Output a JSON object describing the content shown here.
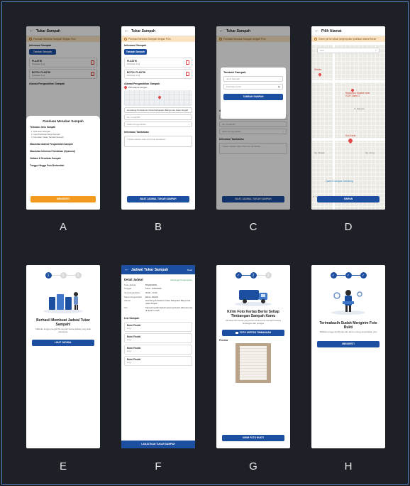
{
  "labels": [
    "A",
    "B",
    "C",
    "D",
    "E",
    "F",
    "G",
    "H"
  ],
  "screenA": {
    "title": "Tukar Sampah",
    "warning": "Panduan Menukar Sampah dengan Poin",
    "info_section": "Informasi Sampah",
    "add_button": "Tambah Sampah",
    "items": [
      {
        "name": "PLASTIK",
        "qty": "Perkiraan 1 kg"
      },
      {
        "name": "BOTOL PLASTIK",
        "qty": "Perkiraan 1 kg"
      }
    ],
    "pickup_label": "Alamat Pengambilan Sampah",
    "sheet_title": "Panduan Menukar Sampah",
    "guide": [
      {
        "title": "Tentukan Jenis Sampah",
        "subs": [
          "1. Pilih Jenis Sampah",
          "2. Input Perkiraan Berat Sampah",
          "3. Kemudian Tekan Tambah Sampah"
        ]
      },
      {
        "title": "Masukkan Alamat Pengambilan Sampah",
        "subs": []
      },
      {
        "title": "Masukkan Informasi Tambahan (Opsional)",
        "subs": []
      },
      {
        "title": "Validasi & Serahkan Sampah",
        "subs": []
      },
      {
        "title": "Tunggu Hingga Poin Bertambah",
        "subs": []
      }
    ],
    "sheet_button": "MENGERTI"
  },
  "screenB": {
    "title": "Tukar Sampah",
    "warning": "Panduan Menukar Sampah dengan Poin",
    "info_section": "Informasi Sampah",
    "add_button": "Tambah Sampah",
    "items": [
      {
        "name": "PLASTIK",
        "qty": "Perkiraan 1 kg"
      },
      {
        "name": "BOTOL PLASTIK",
        "qty": "Perkiraan 1 kg"
      }
    ],
    "pickup_label": "Alamat Pengambilan Sampah",
    "pick_address": "Pilih alamat dengan...",
    "address_text": "Grendeng Purwokerto Utara Kabupaten Banyumas Jawa Tengah",
    "rt_placeholder": "No. rumah/RT",
    "time_placeholder": "Waktu Pengambilan",
    "extra_label": "Informasi Tambahan",
    "extra_placeholder": "Tulisan catatan atau informasi tambahan...",
    "submit": "BUAT JADWAL TUKAR SAMPAH"
  },
  "screenC": {
    "title": "Tukar Sampah",
    "warning": "Panduan Menukar Sampah dengan Poin",
    "modal_title": "Tambah Sampah",
    "type_placeholder": "Jenis Sampah",
    "weight_placeholder": "Perkiraan berat",
    "unit": "kg",
    "modal_button": "TAMBAH SAMPAH",
    "pickup_label": "Alamat Pengambilan Sampah",
    "address_text": "Grendeng Purwokerto Utara Kabupaten Banyumas Jawa Tengah",
    "rt_placeholder": "No. rumah/RT",
    "time_placeholder": "Waktu Pengambilan",
    "extra_label": "Informasi Tambahan",
    "extra_placeholder": "Tulisan catatan atau informasi tambahan...",
    "submit": "BUAT JADWAL TUKAR SAMPAH"
  },
  "screenD": {
    "title": "Pilih Alamat",
    "warning": "Geser pin ke lokasi penjemputan pastikan alamat benar",
    "search_placeholder": "Cari",
    "places": [
      "Wisata",
      "RedDoorz Syariah near GOR Satria 4",
      "Kos Karla",
      "Queen Campus Grendeng"
    ],
    "streets": [
      "Jl. Kampus",
      "Gg. Mawar",
      "Gg. Ireng",
      "Jl. Kampus"
    ],
    "button": "SIMPAN"
  },
  "screenE": {
    "steps": [
      "1",
      "2",
      "3"
    ],
    "heading": "Berhasil Membuat Jadwal Tukar Sampah!",
    "text": "Silahkan tunggu pengambil sampah sesuai jadwal yang telah ditentukan",
    "button": "LIHAT JADWAL"
  },
  "screenF": {
    "title": "Jadwal Tukar Sampah",
    "action": "Batal",
    "section": "Detail Jadwal",
    "status": "Menunggu Penjemputan",
    "rows": [
      {
        "k": "Kode Jadwal",
        "v": "BSH0004811"
      },
      {
        "k": "Tanggal",
        "v": "Senin, 12/09/2022"
      },
      {
        "k": "Jam Pengambilan",
        "v": "09.00 - 12.00"
      },
      {
        "k": "Status Pengambilan",
        "v": "Belum Diambil"
      },
      {
        "k": "Alamat",
        "v": "Grendeng Purwokerto Utara Kabupaten Banyumas Jawa Tengah"
      },
      {
        "k": "Info",
        "v": "Sampah sudah dipisah sesuai jenis dan dikemas rapi di depan rumah"
      }
    ],
    "list_title": "List Sampah",
    "list": [
      {
        "name": "Botol Plastik",
        "qty": "1 kg"
      },
      {
        "name": "Botol Plastik",
        "qty": "1 kg"
      },
      {
        "name": "Botol Plastik",
        "qty": "1 kg"
      },
      {
        "name": "Botol Plastik",
        "qty": "1 kg"
      }
    ],
    "button": "LANJUTKAN TUKAR SAMPAH"
  },
  "screenG": {
    "steps": [
      "✓",
      "2",
      "3"
    ],
    "heading": "Kirim Foto Kertas Berisi Setiap Timbangan Sampah Kamu",
    "text": "Kirimkan foto kertas yang berisi semua jenis sampah beserta timbangan dari petugas",
    "upload_button": "FOTO KERTAS TIMBANGAN",
    "preview_label": "Preview",
    "send_button": "KIRIM FOTO BUKTI"
  },
  "screenH": {
    "steps": [
      "✓",
      "✓",
      "✓"
    ],
    "heading": "Terimakasih Sudah Mengirim Foto Bukti",
    "text": "Silahkan tunggu konfirmasi dari admin untuk penambahan poin",
    "button": "MENGERTI"
  },
  "colors": {
    "primary": "#1d4fa1",
    "accent": "#f29a1f",
    "warning_bg": "#fbe3c1",
    "background": "#1d2127"
  }
}
